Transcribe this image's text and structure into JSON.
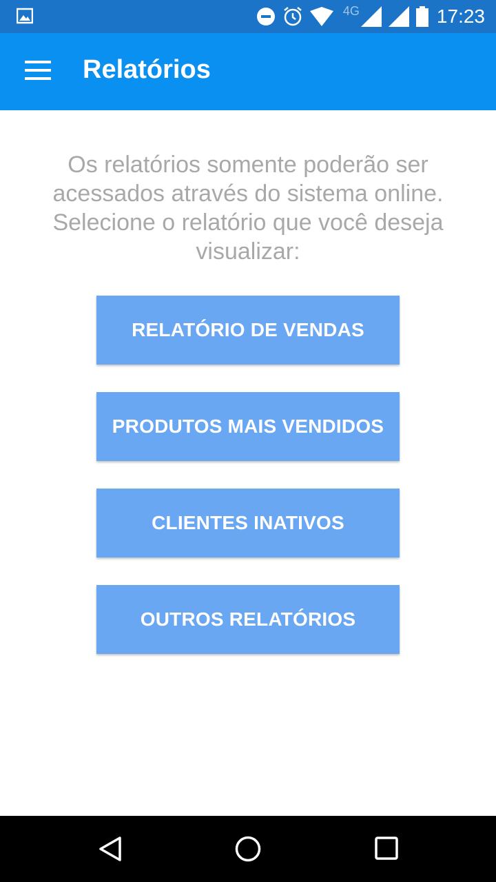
{
  "status_bar": {
    "time": "17:23",
    "network": "4G",
    "icons": [
      "image-notification-icon",
      "do-not-disturb-icon",
      "alarm-icon",
      "wifi-icon",
      "signal-icon",
      "signal-icon",
      "battery-icon"
    ]
  },
  "app_bar": {
    "title": "Relatórios",
    "menu_icon": "hamburger-menu-icon"
  },
  "main": {
    "intro": "Os relatórios somente poderão ser acessados através do sistema online. Selecione o relatório que você deseja visualizar:",
    "buttons": [
      {
        "label": "RELATÓRIO DE VENDAS"
      },
      {
        "label": "PRODUTOS MAIS VENDIDOS"
      },
      {
        "label": "CLIENTES INATIVOS"
      },
      {
        "label": "OUTROS RELATÓRIOS"
      }
    ]
  },
  "nav_bar": {
    "icons": [
      "back-icon",
      "home-icon",
      "recents-icon"
    ]
  },
  "colors": {
    "status_bar": "#1b74c7",
    "app_bar": "#0a90f0",
    "button": "#6aa7f2",
    "intro_text": "#a8a8a8"
  }
}
